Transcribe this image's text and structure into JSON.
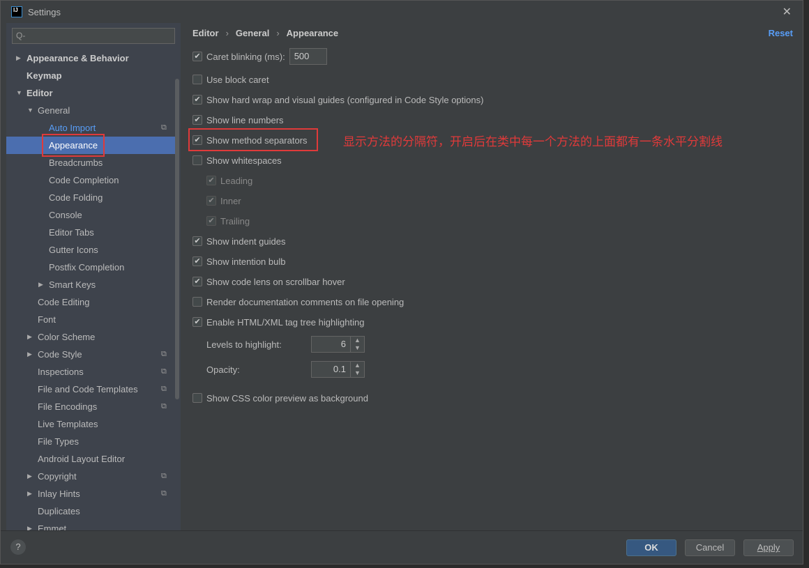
{
  "window": {
    "title": "Settings",
    "logo": "IJ",
    "close": "✕"
  },
  "search": {
    "placeholder": "Q-"
  },
  "tree": [
    {
      "label": "Appearance & Behavior",
      "level": 0,
      "arrow": "▶",
      "bold": true
    },
    {
      "label": "Keymap",
      "level": 0,
      "bold": true
    },
    {
      "label": "Editor",
      "level": 0,
      "arrow": "▼",
      "bold": true
    },
    {
      "label": "General",
      "level": 1,
      "arrow": "▼"
    },
    {
      "label": "Auto Import",
      "level": 2,
      "link": true,
      "copy": true
    },
    {
      "label": "Appearance",
      "level": 2,
      "selected": true
    },
    {
      "label": "Breadcrumbs",
      "level": 2
    },
    {
      "label": "Code Completion",
      "level": 2
    },
    {
      "label": "Code Folding",
      "level": 2
    },
    {
      "label": "Console",
      "level": 2
    },
    {
      "label": "Editor Tabs",
      "level": 2
    },
    {
      "label": "Gutter Icons",
      "level": 2
    },
    {
      "label": "Postfix Completion",
      "level": 2
    },
    {
      "label": "Smart Keys",
      "level": 2,
      "arrow": "▶"
    },
    {
      "label": "Code Editing",
      "level": 1
    },
    {
      "label": "Font",
      "level": 1
    },
    {
      "label": "Color Scheme",
      "level": 1,
      "arrow": "▶"
    },
    {
      "label": "Code Style",
      "level": 1,
      "arrow": "▶",
      "copy": true
    },
    {
      "label": "Inspections",
      "level": 1,
      "copy": true
    },
    {
      "label": "File and Code Templates",
      "level": 1,
      "copy": true
    },
    {
      "label": "File Encodings",
      "level": 1,
      "copy": true
    },
    {
      "label": "Live Templates",
      "level": 1
    },
    {
      "label": "File Types",
      "level": 1
    },
    {
      "label": "Android Layout Editor",
      "level": 1
    },
    {
      "label": "Copyright",
      "level": 1,
      "arrow": "▶",
      "copy": true
    },
    {
      "label": "Inlay Hints",
      "level": 1,
      "arrow": "▶",
      "copy": true
    },
    {
      "label": "Duplicates",
      "level": 1
    },
    {
      "label": "Emmet",
      "level": 1,
      "arrow": "▶"
    }
  ],
  "breadcrumb": [
    "Editor",
    "General",
    "Appearance"
  ],
  "reset": "Reset",
  "options": [
    {
      "label": "Caret blinking (ms):",
      "checked": true,
      "value": "500"
    },
    {
      "label": "Use block caret",
      "checked": false
    },
    {
      "label": "Show hard wrap and visual guides (configured in Code Style options)",
      "checked": true
    },
    {
      "label": "Show line numbers",
      "checked": true
    },
    {
      "label": "Show method separators",
      "checked": true
    },
    {
      "label": "Show whitespaces",
      "checked": false
    },
    {
      "label": "Leading",
      "checked": true,
      "disabled": true,
      "indent": true
    },
    {
      "label": "Inner",
      "checked": true,
      "disabled": true,
      "indent": true
    },
    {
      "label": "Trailing",
      "checked": true,
      "disabled": true,
      "indent": true
    },
    {
      "label": "Show indent guides",
      "checked": true
    },
    {
      "label": "Show intention bulb",
      "checked": true
    },
    {
      "label": "Show code lens on scrollbar hover",
      "checked": true
    },
    {
      "label": "Render documentation comments on file opening",
      "checked": false
    },
    {
      "label": "Enable HTML/XML tag tree highlighting",
      "checked": true
    }
  ],
  "levels": {
    "label": "Levels to highlight:",
    "value": "6"
  },
  "opacity": {
    "label": "Opacity:",
    "value": "0.1"
  },
  "css_preview": {
    "label": "Show CSS color preview as background",
    "checked": false
  },
  "annotation": "显示方法的分隔符，开启后在类中每一个方法的上面都有一条水平分割线",
  "footer": {
    "help": "?",
    "ok": "OK",
    "cancel": "Cancel",
    "apply": "Apply"
  }
}
